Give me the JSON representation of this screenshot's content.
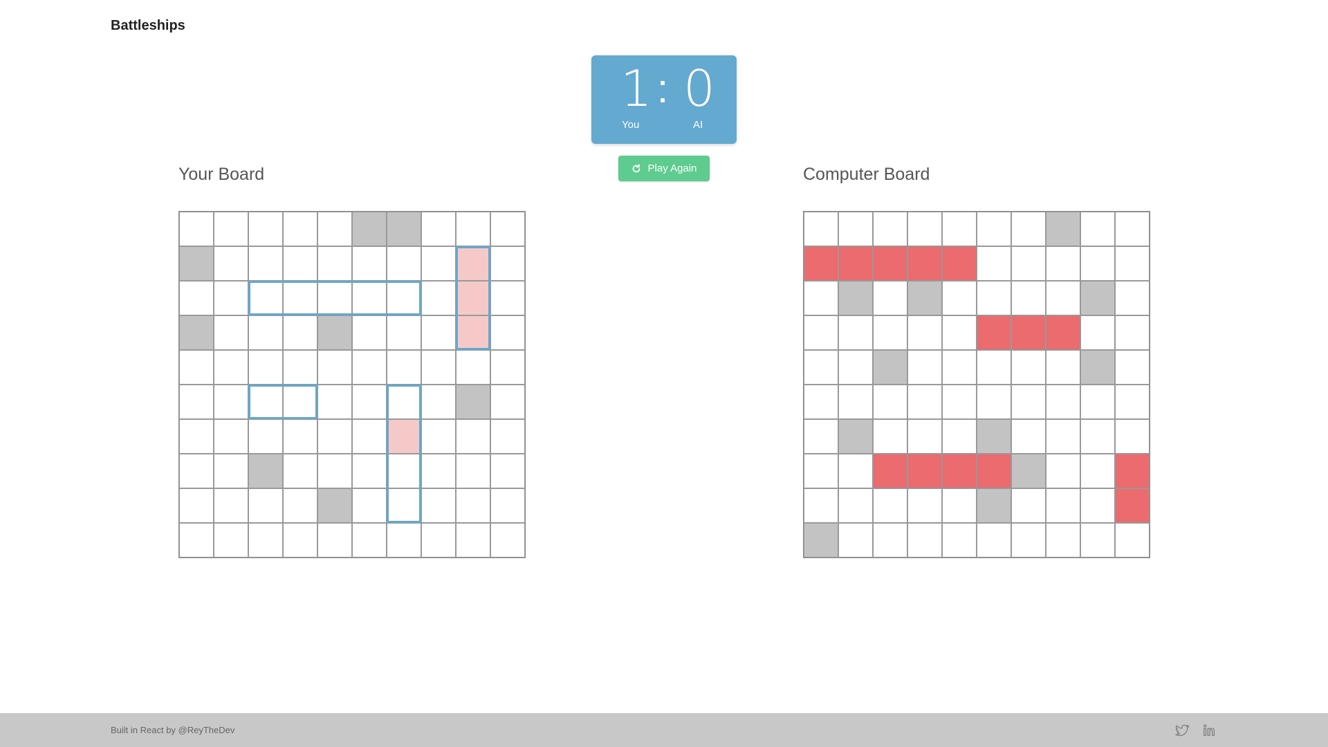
{
  "header": {
    "title": "Battleships"
  },
  "score": {
    "you": "1",
    "separator": ":",
    "ai": "0",
    "you_label": "You",
    "ai_label": "AI"
  },
  "play_again": {
    "label": "Play Again",
    "icon": "refresh-icon"
  },
  "player_board": {
    "title": "Your Board",
    "rows": [
      [
        "empty",
        "empty",
        "empty",
        "empty",
        "empty",
        "miss",
        "miss",
        "empty",
        "empty",
        "empty"
      ],
      [
        "miss",
        "empty",
        "empty",
        "empty",
        "empty",
        "empty",
        "empty",
        "empty",
        "hit-ship",
        "empty"
      ],
      [
        "empty",
        "empty",
        "ship",
        "ship",
        "ship",
        "ship",
        "ship",
        "empty",
        "hit-ship",
        "empty"
      ],
      [
        "miss",
        "empty",
        "empty",
        "empty",
        "miss",
        "empty",
        "empty",
        "empty",
        "hit-ship",
        "empty"
      ],
      [
        "empty",
        "empty",
        "empty",
        "empty",
        "empty",
        "empty",
        "empty",
        "empty",
        "empty",
        "empty"
      ],
      [
        "empty",
        "empty",
        "ship",
        "ship",
        "empty",
        "empty",
        "ship",
        "empty",
        "miss",
        "empty"
      ],
      [
        "empty",
        "empty",
        "empty",
        "empty",
        "empty",
        "empty",
        "hit-ship",
        "empty",
        "empty",
        "empty"
      ],
      [
        "empty",
        "empty",
        "miss",
        "empty",
        "empty",
        "empty",
        "ship",
        "empty",
        "empty",
        "empty"
      ],
      [
        "empty",
        "empty",
        "empty",
        "empty",
        "miss",
        "empty",
        "ship",
        "empty",
        "empty",
        "empty"
      ],
      [
        "empty",
        "empty",
        "empty",
        "empty",
        "empty",
        "empty",
        "empty",
        "empty",
        "empty",
        "empty"
      ]
    ],
    "ships": [
      {
        "row": 2,
        "col": 2,
        "length": 5,
        "orientation": "horizontal"
      },
      {
        "row": 1,
        "col": 8,
        "length": 3,
        "orientation": "vertical"
      },
      {
        "row": 5,
        "col": 2,
        "length": 2,
        "orientation": "horizontal"
      },
      {
        "row": 5,
        "col": 6,
        "length": 4,
        "orientation": "vertical"
      }
    ]
  },
  "computer_board": {
    "title": "Computer Board",
    "rows": [
      [
        "empty",
        "empty",
        "empty",
        "empty",
        "empty",
        "empty",
        "empty",
        "miss",
        "empty",
        "empty"
      ],
      [
        "hit",
        "hit",
        "hit",
        "hit",
        "hit",
        "empty",
        "empty",
        "empty",
        "empty",
        "empty"
      ],
      [
        "empty",
        "miss",
        "empty",
        "miss",
        "empty",
        "empty",
        "empty",
        "empty",
        "miss",
        "empty"
      ],
      [
        "empty",
        "empty",
        "empty",
        "empty",
        "empty",
        "hit",
        "hit",
        "hit",
        "empty",
        "empty"
      ],
      [
        "empty",
        "empty",
        "miss",
        "empty",
        "empty",
        "empty",
        "empty",
        "empty",
        "miss",
        "empty"
      ],
      [
        "empty",
        "empty",
        "empty",
        "empty",
        "empty",
        "empty",
        "empty",
        "empty",
        "empty",
        "empty"
      ],
      [
        "empty",
        "miss",
        "empty",
        "empty",
        "empty",
        "miss",
        "empty",
        "empty",
        "empty",
        "empty"
      ],
      [
        "empty",
        "empty",
        "hit",
        "hit",
        "hit",
        "hit",
        "miss",
        "empty",
        "empty",
        "hit"
      ],
      [
        "empty",
        "empty",
        "empty",
        "empty",
        "empty",
        "miss",
        "empty",
        "empty",
        "empty",
        "hit"
      ],
      [
        "miss",
        "empty",
        "empty",
        "empty",
        "empty",
        "empty",
        "empty",
        "empty",
        "empty",
        "empty"
      ]
    ]
  },
  "footer": {
    "text": "Built in React by @ReyTheDev",
    "icons": [
      "twitter-icon",
      "linkedin-icon"
    ]
  },
  "colors": {
    "score_bg": "#64a9d0",
    "play_again_bg": "#5ecb8f",
    "hit": "#eb6b6e",
    "miss": "#c3c3c3",
    "damaged": "#f6c9c9",
    "ship_outline": "#64a9d0"
  }
}
